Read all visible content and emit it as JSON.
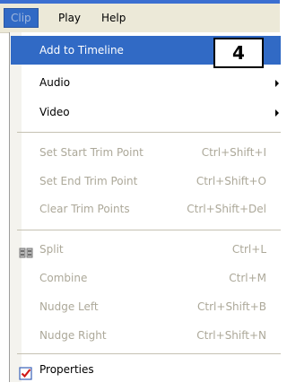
{
  "menubar": {
    "items": [
      {
        "label": "Clip"
      },
      {
        "label": "Play"
      },
      {
        "label": "Help"
      }
    ]
  },
  "menu": {
    "add_to_timeline": "Add to Timeline",
    "audio": "Audio",
    "video": "Video",
    "set_start_trim": {
      "label": "Set Start Trim Point",
      "shortcut": "Ctrl+Shift+I"
    },
    "set_end_trim": {
      "label": "Set End Trim Point",
      "shortcut": "Ctrl+Shift+O"
    },
    "clear_trim": {
      "label": "Clear Trim Points",
      "shortcut": "Ctrl+Shift+Del"
    },
    "split": {
      "label": "Split",
      "shortcut": "Ctrl+L"
    },
    "combine": {
      "label": "Combine",
      "shortcut": "Ctrl+M"
    },
    "nudge_left": {
      "label": "Nudge Left",
      "shortcut": "Ctrl+Shift+B"
    },
    "nudge_right": {
      "label": "Nudge Right",
      "shortcut": "Ctrl+Shift+N"
    },
    "properties": "Properties"
  },
  "callout": {
    "number": "4"
  },
  "colors": {
    "highlight": "#316ac5",
    "disabled_text": "#aca899",
    "menubar_bg": "#ece9d8"
  },
  "icons": {
    "split": "split-icon",
    "properties": "properties-checkmark-icon",
    "submenu": "submenu-arrow-icon"
  }
}
